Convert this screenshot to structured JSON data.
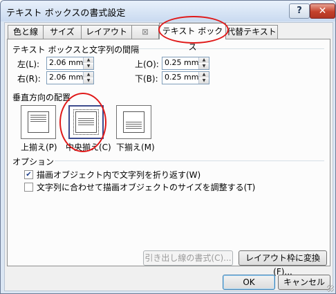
{
  "window": {
    "title": "テキスト ボックスの書式設定",
    "help_glyph": "?",
    "close_glyph": "✕"
  },
  "tabs": [
    {
      "label": "色と線"
    },
    {
      "label": "サイズ"
    },
    {
      "label": "レイアウト"
    },
    {
      "label": "⊠"
    },
    {
      "label": "テキスト ボックス"
    },
    {
      "label": "代替テキスト"
    }
  ],
  "active_tab": "テキスト ボックス",
  "internal_margin": {
    "heading": "テキスト ボックスと文字列の間隔",
    "left": {
      "label": "左(L):",
      "value": "2.06 mm"
    },
    "right": {
      "label": "右(R):",
      "value": "2.06 mm"
    },
    "top": {
      "label": "上(O):",
      "value": "0.25 mm"
    },
    "bottom": {
      "label": "下(B):",
      "value": "0.25 mm"
    }
  },
  "vertical_alignment": {
    "heading": "垂直方向の配置",
    "options": [
      {
        "label": "上揃え(P)",
        "selected": false
      },
      {
        "label": "中央揃え(C)",
        "selected": true
      },
      {
        "label": "下揃え(M)",
        "selected": false
      }
    ]
  },
  "options": {
    "heading": "オプション",
    "wrap_text": {
      "label": "描画オブジェクト内で文字列を折り返す(W)",
      "checked": true,
      "mark": "✔"
    },
    "resize_shape": {
      "label": "文字列に合わせて描画オブジェクトのサイズを調整する(T)",
      "checked": false
    }
  },
  "panel_buttons": {
    "callout": "引き出し線の書式(C)...",
    "convert_frame": "レイアウト枠に変換(F)..."
  },
  "dialog_buttons": {
    "ok": "OK",
    "cancel": "キャンセル"
  },
  "spin_glyphs": {
    "up": "▲",
    "down": "▼"
  },
  "annotation_color": "#e01818"
}
